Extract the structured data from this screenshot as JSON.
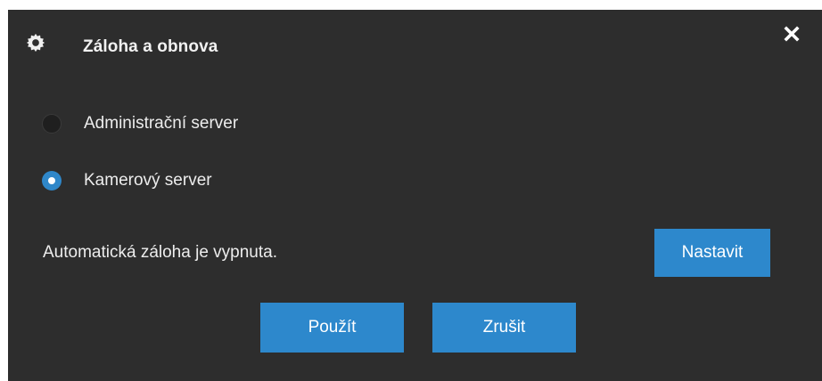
{
  "dialog": {
    "title": "Záloha a obnova",
    "header_icon": "gear-icon",
    "close_icon": "close-icon"
  },
  "options": [
    {
      "label": "Administrační server",
      "selected": false
    },
    {
      "label": "Kamerový server",
      "selected": true
    }
  ],
  "status": {
    "text": "Automatická záloha je vypnuta."
  },
  "buttons": {
    "settings_label": "Nastavit",
    "apply_label": "Použít",
    "cancel_label": "Zrušit"
  },
  "colors": {
    "dialog_background": "#2d2d2d",
    "accent": "#2d88cc",
    "text": "#ededed"
  }
}
